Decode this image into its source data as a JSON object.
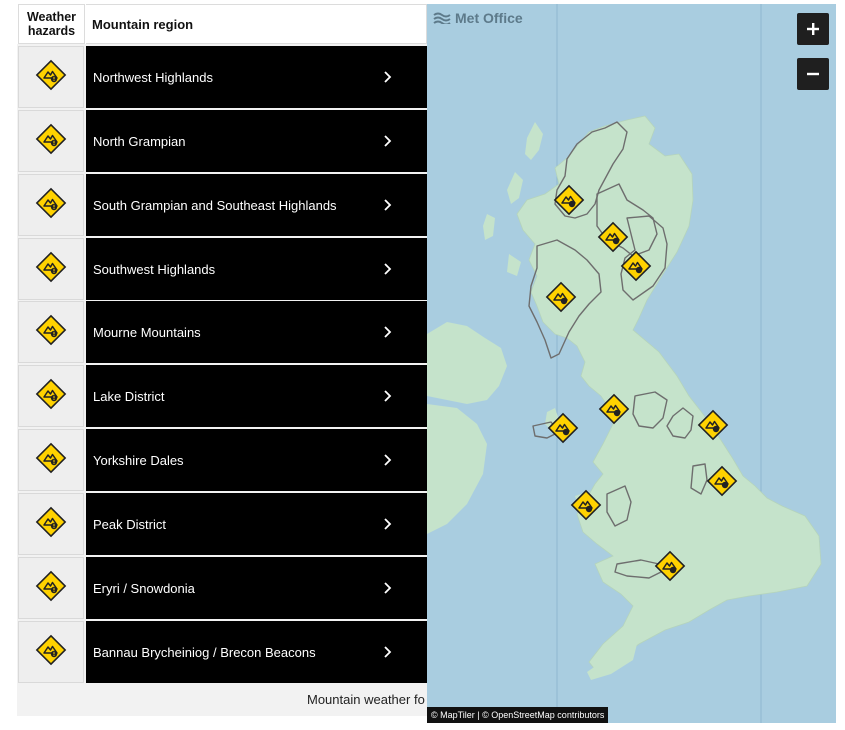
{
  "table": {
    "header_hazards": "Weather hazards",
    "header_region": "Mountain region",
    "rows": [
      {
        "region": "Northwest Highlands",
        "hazard_icon": "mountain-warning-icon"
      },
      {
        "region": "North Grampian",
        "hazard_icon": "mountain-warning-icon"
      },
      {
        "region": "South Grampian and Southeast Highlands",
        "hazard_icon": "mountain-warning-icon"
      },
      {
        "region": "Southwest Highlands",
        "hazard_icon": "mountain-warning-icon"
      },
      {
        "region": "Mourne Mountains",
        "hazard_icon": "mountain-warning-icon"
      },
      {
        "region": "Lake District",
        "hazard_icon": "mountain-warning-icon"
      },
      {
        "region": "Yorkshire Dales",
        "hazard_icon": "mountain-warning-icon"
      },
      {
        "region": "Peak District",
        "hazard_icon": "mountain-warning-icon"
      },
      {
        "region": "Eryri / Snowdonia",
        "hazard_icon": "mountain-warning-icon"
      },
      {
        "region": "Bannau Brycheiniog / Brecon Beacons",
        "hazard_icon": "mountain-warning-icon"
      }
    ],
    "footer_text": "Mountain weather fo"
  },
  "map": {
    "logo_text": "Met Office",
    "zoom_in": "+",
    "zoom_out": "−",
    "attribution": "© MapTiler | © OpenStreetMap contributors",
    "colors": {
      "sea": "#a9cde0",
      "land": "#c5e3cb",
      "region_border": "#6e6e6e",
      "warning": "#ffd200"
    }
  }
}
